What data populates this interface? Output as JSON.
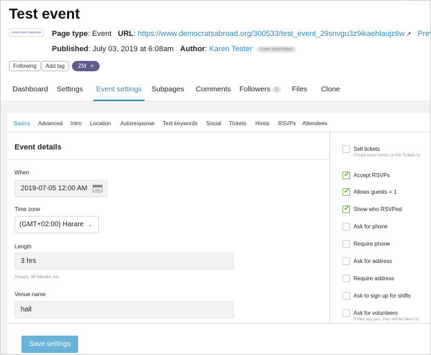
{
  "page": {
    "title": "Test event",
    "logo_text": "DEMOCRATS ABROAD",
    "page_type_label": "Page type",
    "page_type_value": "Event",
    "url_label": "URL",
    "url_value": "https://www.democratsabroad.org/300533/test_event_29snvgu3z9ikaehlaujz6w",
    "preview_label": "Preview",
    "published_label": "Published",
    "published_value": "July 03, 2019 at 6:08am",
    "author_label": "Author",
    "author_value": "Karen Tester",
    "author_badge": "User submitted"
  },
  "actions": {
    "following": "Following",
    "add_tag": "Add tag",
    "tag": "ZM",
    "tag_remove": "×"
  },
  "main_tabs": [
    {
      "label": "Dashboard"
    },
    {
      "label": "Settings"
    },
    {
      "label": "Event settings",
      "active": true
    },
    {
      "label": "Subpages"
    },
    {
      "label": "Comments"
    },
    {
      "label": "Followers",
      "count": "1"
    },
    {
      "label": "Files"
    },
    {
      "label": "Clone"
    }
  ],
  "sub_tabs": [
    {
      "label": "Basics",
      "active": true
    },
    {
      "label": "Advanced"
    },
    {
      "label": "Intro"
    },
    {
      "label": "Location"
    },
    {
      "label": "Autoresponse"
    },
    {
      "label": "Text keywords"
    },
    {
      "label": "Social"
    },
    {
      "label": "Tickets"
    },
    {
      "label": "Hosts"
    },
    {
      "label": "RSVPs"
    },
    {
      "label": "Attendees"
    }
  ],
  "form": {
    "section_title": "Event details",
    "when_label": "When",
    "when_value": "2019-07-05 12:00 AM",
    "timezone_label": "Time zone",
    "timezone_value": "(GMT+02:00) Harare",
    "length_label": "Length",
    "length_value": "3 hrs",
    "length_hint": "3 hours, 30 minutes, etc.",
    "venue_label": "Venue name",
    "venue_value": "hall"
  },
  "options": [
    {
      "label": "Sell tickets",
      "checked": false,
      "sub": "Create ticket levels on the Tickets ta"
    },
    {
      "label": "Accept RSVPs",
      "checked": true
    },
    {
      "label": "Allows guests + 1",
      "checked": true
    },
    {
      "label": "Show who RSVPed",
      "checked": true
    },
    {
      "label": "Ask for phone",
      "checked": false
    },
    {
      "label": "Require phone",
      "checked": false
    },
    {
      "label": "Ask for address",
      "checked": false
    },
    {
      "label": "Require address",
      "checked": false
    },
    {
      "label": "Ask to sign up for shifts",
      "checked": false
    },
    {
      "label": "Ask for volunteers",
      "checked": false,
      "sub": "If they say yes, they will be taken to"
    }
  ],
  "footer": {
    "save_label": "Save settings"
  },
  "colors": {
    "accent": "#2a8ab5",
    "save_button": "#6ab3d8",
    "tag": "#5f5a8f",
    "check": "#5a9a28"
  }
}
